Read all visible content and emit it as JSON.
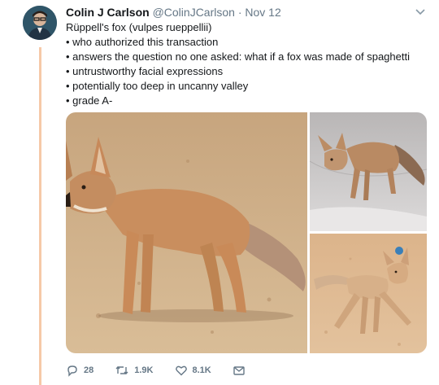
{
  "tweet": {
    "author_name": "Colin J Carlson",
    "author_handle": "@ColinJCarlson",
    "separator": "·",
    "date": "Nov 12",
    "lines": [
      "Rüppell's fox (vulpes rueppellii)",
      "• who authorized this transaction",
      "• answers the question no one asked: what if a fox was made of spaghetti",
      "• untrustworthy facial expressions",
      "• potentially too deep in uncanny valley",
      "• grade A-"
    ]
  },
  "actions": {
    "reply_count": "28",
    "retweet_count": "1.9K",
    "like_count": "8.1K"
  },
  "icons": {
    "reply": "reply-icon",
    "retweet": "retweet-icon",
    "like": "heart-icon",
    "dm": "envelope-icon",
    "caret": "chevron-down-icon"
  },
  "colors": {
    "thread_line": "#f6c9a8",
    "muted": "#657786",
    "text": "#14171a"
  }
}
